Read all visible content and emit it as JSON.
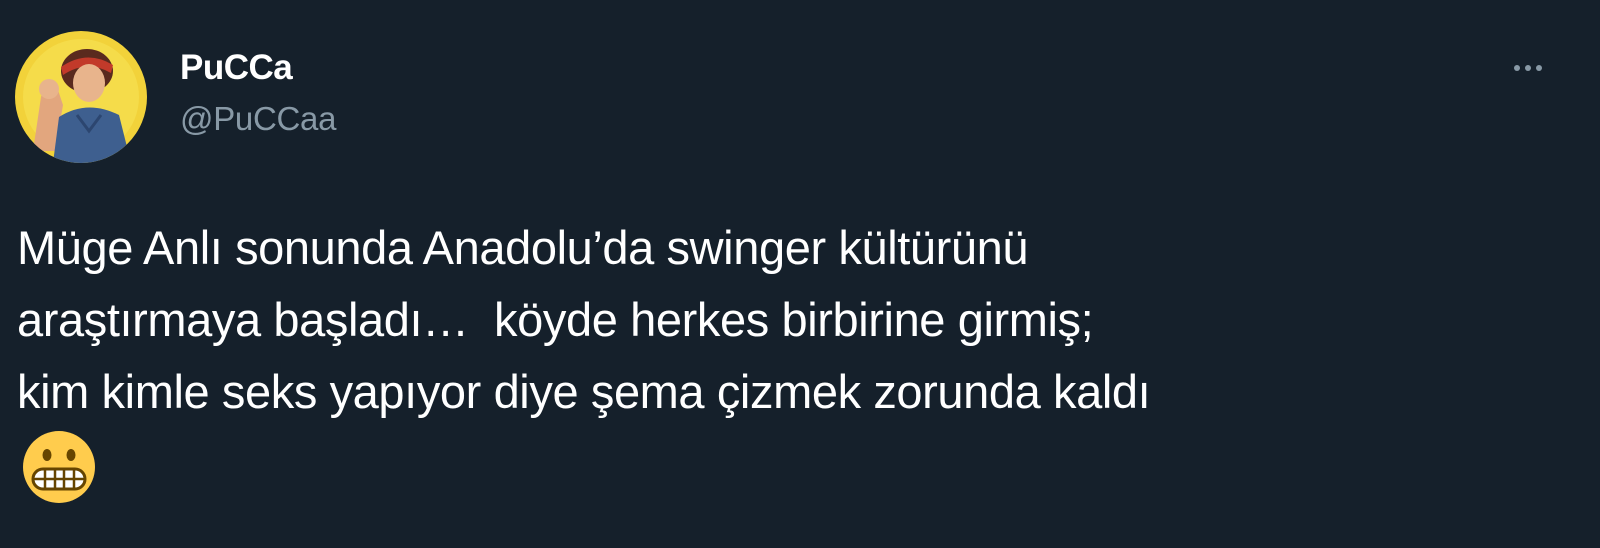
{
  "tweet": {
    "author": {
      "display_name": "PuCCa",
      "handle": "@PuCCaa",
      "avatar": "profile-photo"
    },
    "more_icon": "more-horizontal-icon",
    "text_lines": [
      "Müge Anlı sonunda Anadolu’da swinger kültürünü",
      "araştırmaya başladı…  köyde herkes birbirine girmiş;",
      "kim kimle seks yapıyor diye şema çizmek zorunda kaldı"
    ],
    "emoji": "grimacing-face-emoji"
  },
  "colors": {
    "background": "#15202b",
    "text_primary": "#ffffff",
    "text_secondary": "#8899a6",
    "emoji_yellow": "#ffcc4d"
  }
}
